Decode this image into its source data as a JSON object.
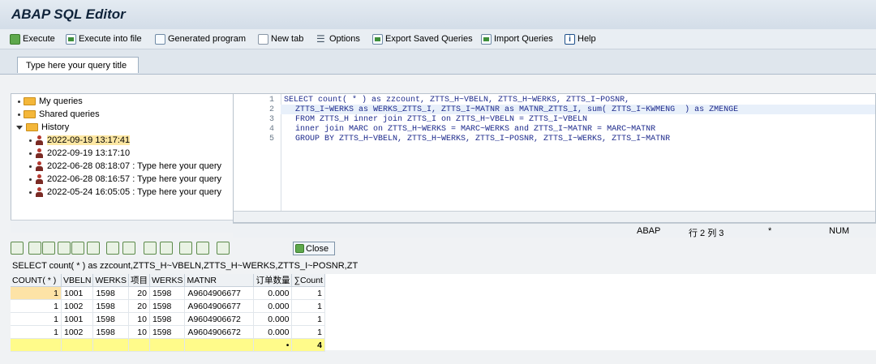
{
  "app": {
    "title": "ABAP SQL Editor"
  },
  "toolbar": {
    "execute": "Execute",
    "execute_file": "Execute into file",
    "generated": "Generated program",
    "new_tab": "New tab",
    "options": "Options",
    "export": "Export Saved Queries",
    "import": "Import Queries",
    "help": "Help"
  },
  "tab": {
    "label": "Type here your query title"
  },
  "tree": {
    "my_queries": "My queries",
    "shared": "Shared queries",
    "history": "History",
    "entries": [
      "2022-09-19 13:17:41",
      "2022-09-19 13:17:10",
      "2022-06-28 08:18:07 :  Type here your query",
      "2022-06-28 08:16:57 :  Type here your query",
      "2022-05-24 16:05:05 :  Type here your query"
    ]
  },
  "editor": {
    "lines": [
      "SELECT count( * ) as zzcount, ZTTS_H~VBELN, ZTTS_H~WERKS, ZTTS_I~POSNR,",
      "ZTTS_I~WERKS as WERKS_ZTTS_I, ZTTS_I~MATNR as MATNR_ZTTS_I, sum( ZTTS_I~KWMENG  ) as ZMENGE",
      "FROM ZTTS_H inner join ZTTS_I on ZTTS_H~VBELN = ZTTS_I~VBELN",
      "inner join MARC on ZTTS_H~WERKS = MARC~WERKS and ZTTS_I~MATNR = MARC~MATNR",
      "GROUP BY ZTTS_H~VBELN, ZTTS_H~WERKS, ZTTS_I~POSNR, ZTTS_I~WERKS, ZTTS_I~MATNR"
    ],
    "line_numbers": [
      "1",
      "2",
      "3",
      "4",
      "5"
    ]
  },
  "status": {
    "lang": "ABAP",
    "pos_label": "行 2 列 3",
    "star": "*",
    "num": "NUM"
  },
  "alv": {
    "close": "Close"
  },
  "summary": "SELECT count( * ) as zzcount,ZTTS_H~VBELN,ZTTS_H~WERKS,ZTTS_I~POSNR,ZT",
  "results": {
    "headers": [
      "COUNT( * )",
      "VBELN",
      "WERKS",
      "项目",
      "WERKS",
      "MATNR",
      "订单数量",
      "∑Count"
    ],
    "rows": [
      [
        "1",
        "1001",
        "1598",
        "20",
        "1598",
        "A9604906677",
        "0.000",
        "1"
      ],
      [
        "1",
        "1002",
        "1598",
        "20",
        "1598",
        "A9604906677",
        "0.000",
        "1"
      ],
      [
        "1",
        "1001",
        "1598",
        "10",
        "1598",
        "A9604906672",
        "0.000",
        "1"
      ],
      [
        "1",
        "1002",
        "1598",
        "10",
        "1598",
        "A9604906672",
        "0.000",
        "1"
      ]
    ],
    "total_marker": "•",
    "total": "4"
  }
}
